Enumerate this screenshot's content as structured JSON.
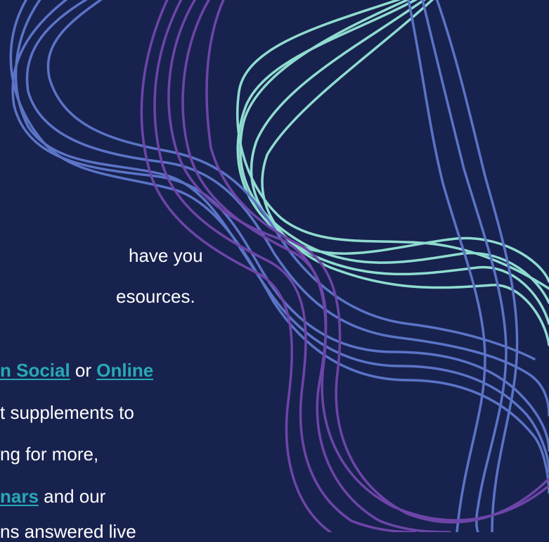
{
  "text": {
    "line1": "have you",
    "line2": "esources.",
    "line3_link1": "n Social",
    "line3_mid": " or ",
    "line3_link2": "Online",
    "line4": "t supplements to",
    "line5": "ng for more,",
    "line6_link": "nars",
    "line6_rest": " and our",
    "line7": "ns answered live"
  },
  "colors": {
    "background": "#18224e",
    "link": "#28a9b6",
    "mint_strand": "#8fdcd0",
    "blue_strand": "#5b74c7",
    "purple_strand": "#6d45a8"
  }
}
